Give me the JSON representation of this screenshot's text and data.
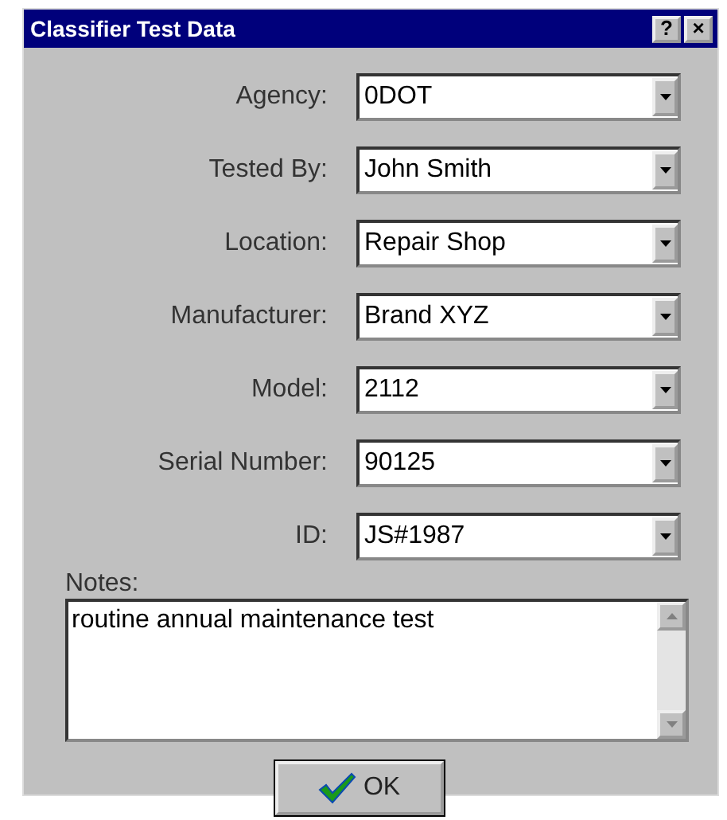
{
  "window": {
    "title": "Classifier Test Data",
    "title_buttons": [
      "?",
      "×"
    ]
  },
  "fields": [
    {
      "label": "Agency:",
      "value": "0DOT"
    },
    {
      "label": "Tested By:",
      "value": "John Smith"
    },
    {
      "label": "Location:",
      "value": "Repair Shop"
    },
    {
      "label": "Manufacturer:",
      "value": "Brand XYZ"
    },
    {
      "label": "Model:",
      "value": "2112"
    },
    {
      "label": "Serial Number:",
      "value": "90125"
    },
    {
      "label": "ID:",
      "value": "JS#1987"
    }
  ],
  "notes": {
    "label": "Notes:",
    "value": "routine annual maintenance test"
  },
  "buttons": [
    {
      "label": "OK"
    }
  ]
}
